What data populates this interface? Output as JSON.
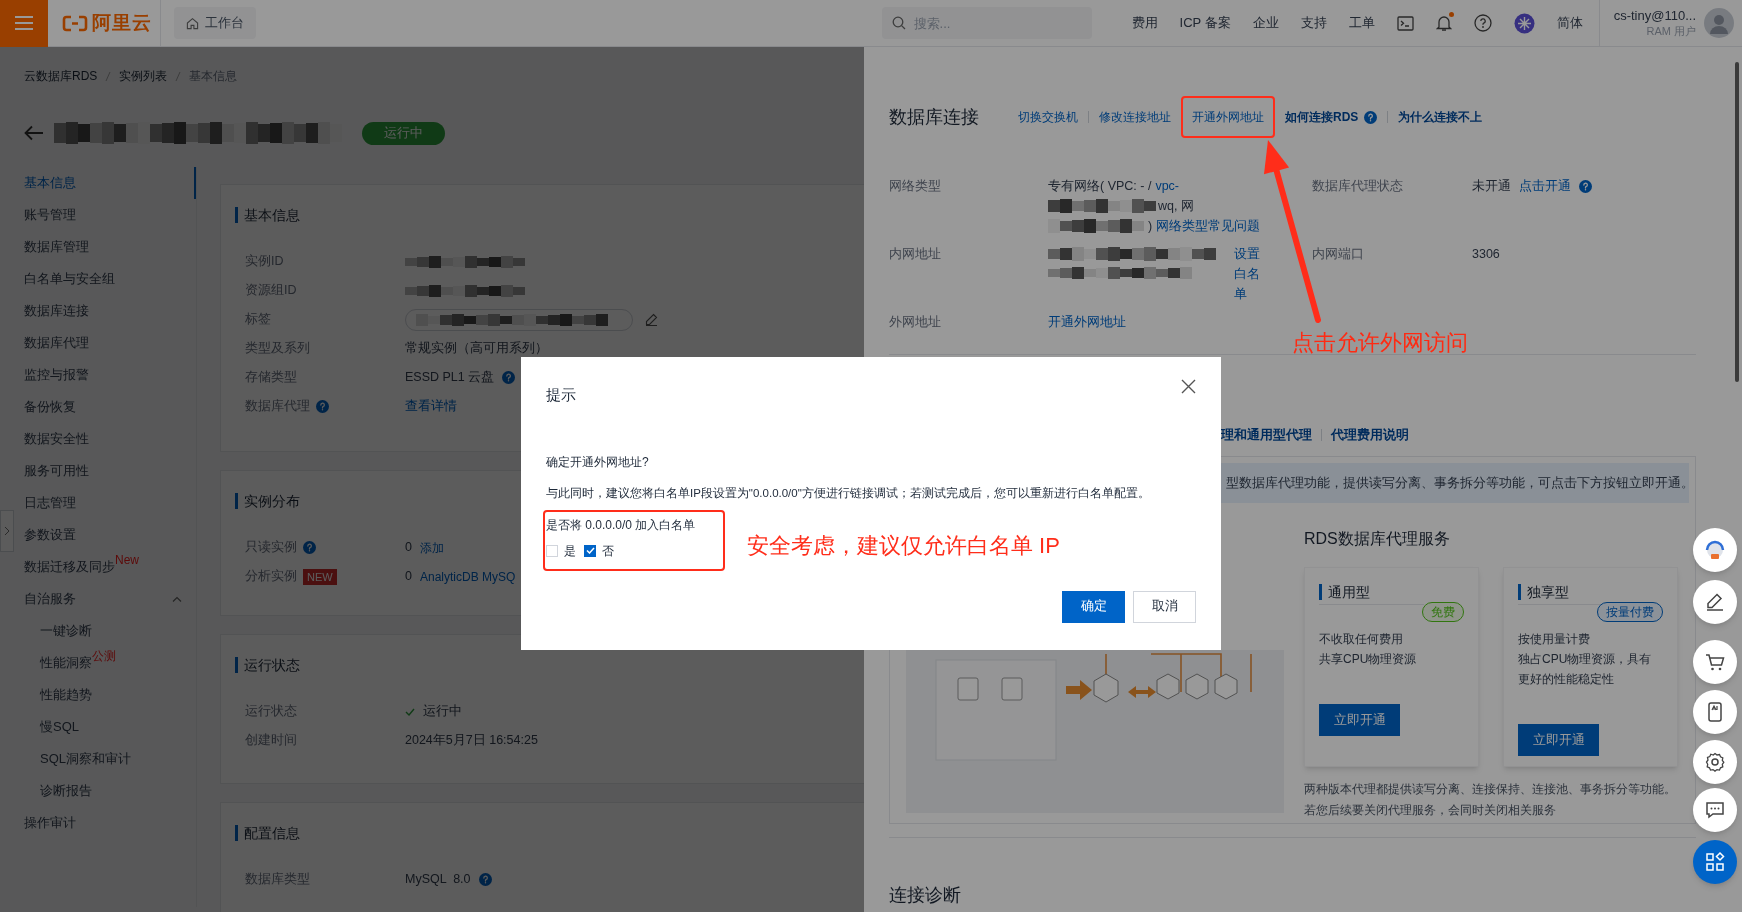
{
  "topbar": {
    "logo": "阿里云",
    "workbench": "工作台",
    "search_placeholder": "搜索...",
    "nav": [
      "费用",
      "ICP 备案",
      "企业",
      "支持",
      "工单"
    ],
    "notification": true,
    "language": "简体",
    "user_name": "cs-tiny@110...",
    "user_role": "RAM 用户"
  },
  "breadcrumb": [
    {
      "label": "云数据库RDS",
      "current": false
    },
    {
      "label": "实例列表",
      "current": false
    },
    {
      "label": "基本信息",
      "current": true
    }
  ],
  "instance_status": "运行中",
  "sidebar": {
    "items": [
      {
        "label": "基本信息",
        "selected": true
      },
      {
        "label": "账号管理",
        "selected": false
      },
      {
        "label": "数据库管理",
        "selected": false
      },
      {
        "label": "白名单与安全组",
        "selected": false
      },
      {
        "label": "数据库连接",
        "selected": false
      },
      {
        "label": "数据库代理",
        "selected": false
      },
      {
        "label": "监控与报警",
        "selected": false
      },
      {
        "label": "备份恢复",
        "selected": false
      },
      {
        "label": "数据安全性",
        "selected": false
      },
      {
        "label": "服务可用性",
        "selected": false
      },
      {
        "label": "日志管理",
        "selected": false
      },
      {
        "label": "参数设置",
        "selected": false
      },
      {
        "label": "数据迁移及同步",
        "selected": false,
        "badge": "New"
      },
      {
        "label": "自治服务",
        "selected": false,
        "expanded": true,
        "children": [
          {
            "label": "一键诊断",
            "selected": false
          },
          {
            "label": "性能洞察",
            "selected": false,
            "badge": "公测"
          },
          {
            "label": "性能趋势",
            "selected": false
          },
          {
            "label": "慢SQL",
            "selected": false
          },
          {
            "label": "SQL洞察和审计",
            "selected": false
          },
          {
            "label": "诊断报告",
            "selected": false
          }
        ]
      },
      {
        "label": "操作审计",
        "selected": false
      }
    ]
  },
  "sections": [
    {
      "title": "基本信息",
      "rows": [
        {
          "label": "实例ID",
          "kind": "mosaic"
        },
        {
          "label": "资源组ID",
          "kind": "mosaic"
        },
        {
          "label": "标签",
          "kind": "tag"
        },
        {
          "label": "类型及系列",
          "kind": "text",
          "value": "常规实例（高可用系列）"
        },
        {
          "label": "存储类型",
          "kind": "text",
          "value": "ESSD PL1 云盘",
          "value_help": true
        },
        {
          "label": "数据库代理",
          "kind": "link",
          "label_help": true,
          "link": "查看详情"
        }
      ]
    },
    {
      "title": "实例分布",
      "rows": [
        {
          "label": "只读实例",
          "kind": "count",
          "label_help": true,
          "value": "0",
          "link": "添加"
        },
        {
          "label": "分析实例",
          "kind": "count",
          "label_badge": "NEW",
          "value": "0",
          "link": "AnalyticDB MySQ"
        }
      ]
    },
    {
      "title": "运行状态",
      "rows": [
        {
          "label": "运行状态",
          "kind": "status",
          "value": "运行中"
        },
        {
          "label": "创建时间",
          "kind": "text",
          "value": "2024年5月7日 16:54:25"
        }
      ]
    },
    {
      "title": "配置信息",
      "rows": [
        {
          "label": "数据库类型",
          "kind": "text",
          "value": "MySQL  8.0",
          "value_help": true
        }
      ]
    }
  ],
  "connection": {
    "title": "数据库连接",
    "links": [
      {
        "label": "切换交换机",
        "bold": false,
        "help": false,
        "highlighted": false
      },
      {
        "label": "修改连接地址",
        "bold": false,
        "help": false,
        "highlighted": false
      },
      {
        "label": "开通外网地址",
        "bold": false,
        "help": false,
        "highlighted": true
      },
      {
        "label": "如何连接RDS",
        "bold": true,
        "help": true,
        "highlighted": false
      },
      {
        "label": "为什么连接不上",
        "bold": true,
        "help": false,
        "highlighted": false
      }
    ],
    "network_type": {
      "label": "网络类型",
      "text": "专有网络( VPC: - /",
      "vpc_link": "vpc-",
      "line2_text": "wq, 网",
      "line3_text": ")",
      "faq_link": "网络类型常见问题"
    },
    "proxy_status": {
      "label": "数据库代理状态",
      "value": "未开通",
      "link": "点击开通"
    },
    "internal_address": {
      "label": "内网地址",
      "link": "设置白名单"
    },
    "internal_port": {
      "label": "内网端口",
      "value": "3306"
    },
    "external_address": {
      "label": "外网地址",
      "link": "开通外网地址"
    }
  },
  "proxy": {
    "links": [
      "理和通用型代理",
      "代理费用说明"
    ],
    "banner": "型数据库代理功能，提供读写分离、事务拆分等功能，可点击下方按钮立即开通。",
    "title": "RDS数据库代理服务",
    "plans": [
      {
        "name": "通用型",
        "badge": "免费",
        "kind": "free",
        "lines": [
          "不收取任何费用",
          "共享CPU物理资源"
        ],
        "button": "立即开通"
      },
      {
        "name": "独享型",
        "badge": "按量付费",
        "kind": "metered",
        "lines": [
          "按使用量计费",
          "独占CPU物理资源，具有",
          "更好的性能稳定性"
        ],
        "button": "立即开通"
      }
    ],
    "footnote": [
      "两种版本代理都提供读写分离、连接保持、连接池、事务拆分等功能。",
      "若您后续要关闭代理服务，会同时关闭相关服务"
    ]
  },
  "diagnostics_title": "连接诊断",
  "dialog": {
    "title": "提示",
    "question": "确定开通外网地址?",
    "note": "与此同时，建议您将白名单IP段设置为\"0.0.0.0/0\"方便进行链接调试；若测试完成后，您可以重新进行白名单配置。",
    "option_label": "是否将 0.0.0.0/0 加入白名单",
    "options": [
      {
        "label": "是",
        "checked": false
      },
      {
        "label": "否",
        "checked": true
      }
    ],
    "buttons": [
      {
        "label": "确定",
        "kind": "primary"
      },
      {
        "label": "取消",
        "kind": "default"
      }
    ]
  },
  "annotations": [
    {
      "text": "点击允许外网访问"
    },
    {
      "text": "安全考虑，建议仅允许白名单 IP"
    }
  ]
}
